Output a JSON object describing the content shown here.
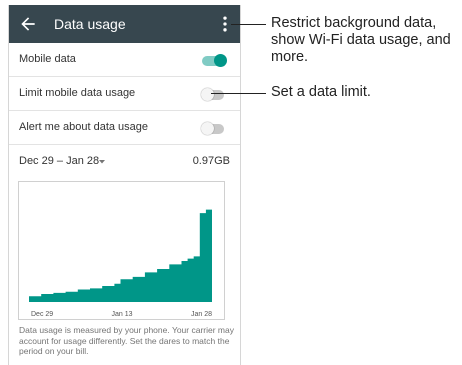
{
  "app_bar": {
    "title": "Data usage",
    "back_icon": "arrow-back-icon",
    "overflow_icon": "more-vert-icon",
    "color": "#37474f"
  },
  "settings": {
    "mobile_data": {
      "label": "Mobile data",
      "enabled": true
    },
    "limit_mobile_data": {
      "label": "Limit mobile data usage",
      "enabled": false
    },
    "alert_data_usage": {
      "label": "Alert me about data usage",
      "enabled": false
    }
  },
  "cycle": {
    "range": "Dec 29 – Jan 28",
    "usage": "0.97GB"
  },
  "accent_color": "#009688",
  "chart_data": {
    "type": "area",
    "x_tick_labels": [
      "Dec 29",
      "Jan 13",
      "Jan 28"
    ],
    "x_day_index": [
      0,
      2,
      4,
      6,
      8,
      10,
      12,
      14,
      15,
      17,
      19,
      21,
      23,
      25,
      26,
      27,
      28,
      29
    ],
    "cumulative_usage_fraction": [
      0.05,
      0.07,
      0.08,
      0.09,
      0.11,
      0.12,
      0.14,
      0.16,
      0.2,
      0.22,
      0.26,
      0.29,
      0.33,
      0.36,
      0.38,
      0.4,
      0.78,
      0.81
    ],
    "color": "#009688",
    "grid": false
  },
  "footnote": "Data usage is measured by your phone. Your carrier may account for usage differently. Set the dares to match the period on your bill.",
  "callouts": [
    {
      "text": "Restrict background data, show Wi-Fi data usage, and more."
    },
    {
      "text": "Set a data limit."
    }
  ]
}
